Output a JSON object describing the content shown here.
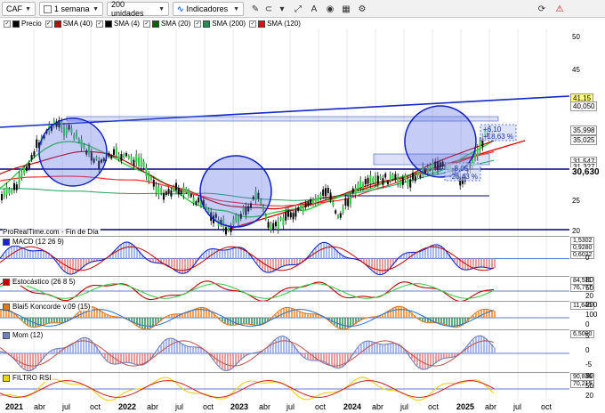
{
  "toolbar": {
    "symbol": "CAF",
    "period": "1 semana",
    "units": "200 unidades",
    "indicators": "Indicadores"
  },
  "legend": [
    {
      "label": "Precio",
      "color": "#000000"
    },
    {
      "label": "SMA (40)",
      "color": "#c00000"
    },
    {
      "label": "SMA (4)",
      "color": "#000000"
    },
    {
      "label": "SMA (20)",
      "color": "#006400"
    },
    {
      "label": "SMA (200)",
      "color": "#2e8b57"
    },
    {
      "label": "SMA (120)",
      "color": "#ff0000"
    }
  ],
  "price_axis": [
    "50",
    "45",
    "40",
    "35",
    "30",
    "25",
    "20"
  ],
  "price_tags": [
    {
      "text": "41,15",
      "bg": "#ffff80"
    },
    {
      "text": "40,050",
      "bg": "#ffffff"
    },
    {
      "text": "35,998",
      "bg": "#ffffff"
    },
    {
      "text": "35,025",
      "bg": "#ffffff"
    },
    {
      "text": "31,547",
      "bg": "#ffffff"
    },
    {
      "text": "31,327",
      "bg": "#ffffff"
    },
    {
      "text": "30,630",
      "bg": "#ffffff"
    }
  ],
  "annotations": {
    "up_change": "+6,10",
    "up_pct": "+18,63 %",
    "down_change": "-8,05",
    "down_pct": "-26,43 %"
  },
  "source": "ProRealTime.com - Fin de Día",
  "indicators": [
    {
      "name": "MACD (12 26 9)",
      "values": [
        "1,5302",
        "0,9280",
        "0,6022"
      ],
      "axis": [
        "0"
      ]
    },
    {
      "name": "Estocástico (26 8 5)",
      "values": [
        "84,511",
        "76,777"
      ],
      "axis": [
        "80",
        "50",
        "20"
      ]
    },
    {
      "name": "Blai5 Koncorde v.09 (15)",
      "values": [
        "11,640"
      ],
      "axis": [
        "200",
        "100",
        "0"
      ]
    },
    {
      "name": "Mom (12)",
      "values": [
        "6,5000"
      ],
      "axis": [
        "5",
        "0",
        "-5"
      ]
    },
    {
      "name": "FILTRO RSI",
      "values": [
        "90,836",
        "70,215"
      ],
      "axis": [
        "80",
        "50",
        "20"
      ]
    }
  ],
  "x_axis": [
    {
      "label": "2021",
      "bold": true
    },
    {
      "label": "abr",
      "bold": false
    },
    {
      "label": "jul",
      "bold": false
    },
    {
      "label": "oct",
      "bold": false
    },
    {
      "label": "2022",
      "bold": true
    },
    {
      "label": "abr",
      "bold": false
    },
    {
      "label": "jul",
      "bold": false
    },
    {
      "label": "oct",
      "bold": false
    },
    {
      "label": "2023",
      "bold": true
    },
    {
      "label": "abr",
      "bold": false
    },
    {
      "label": "jul",
      "bold": false
    },
    {
      "label": "oct",
      "bold": false
    },
    {
      "label": "2024",
      "bold": true
    },
    {
      "label": "abr",
      "bold": false
    },
    {
      "label": "jul",
      "bold": false
    },
    {
      "label": "oct",
      "bold": false
    },
    {
      "label": "2025",
      "bold": true
    },
    {
      "label": "abr",
      "bold": false
    },
    {
      "label": "jul",
      "bold": false
    },
    {
      "label": "oct",
      "bold": false
    }
  ]
}
